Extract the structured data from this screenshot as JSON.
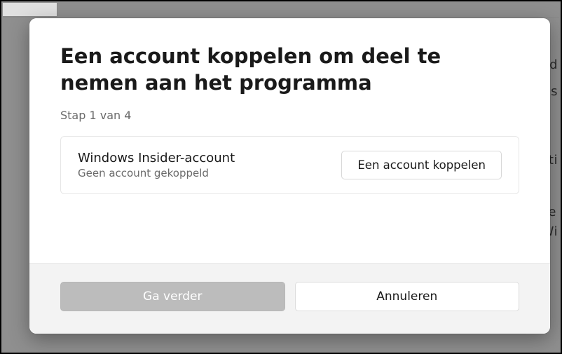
{
  "background": {
    "text_fragment_1": "rd",
    "text_fragment_2": "vs",
    "text_fragment_3": "rti",
    "text_fragment_4": "e",
    "text_fragment_5": "Wi"
  },
  "dialog": {
    "title": "Een account koppelen om deel te nemen aan het programma",
    "step": "Stap 1 van 4",
    "account": {
      "label": "Windows Insider-account",
      "status": "Geen account gekoppeld",
      "link_button": "Een account koppelen"
    },
    "footer": {
      "continue": "Ga verder",
      "cancel": "Annuleren"
    }
  }
}
